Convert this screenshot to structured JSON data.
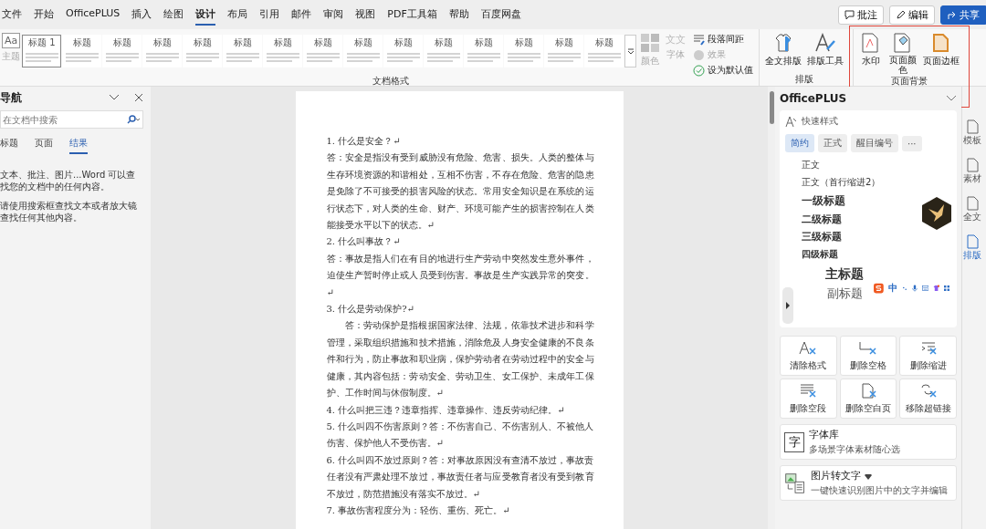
{
  "menu_tabs": [
    {
      "label": "文件",
      "selected": false
    },
    {
      "label": "开始",
      "selected": false
    },
    {
      "label": "OfficePLUS",
      "selected": false
    },
    {
      "label": "插入",
      "selected": false
    },
    {
      "label": "绘图",
      "selected": false
    },
    {
      "label": "设计",
      "selected": true
    },
    {
      "label": "布局",
      "selected": false
    },
    {
      "label": "引用",
      "selected": false
    },
    {
      "label": "邮件",
      "selected": false
    },
    {
      "label": "审阅",
      "selected": false
    },
    {
      "label": "视图",
      "selected": false
    },
    {
      "label": "PDF工具箱",
      "selected": false
    },
    {
      "label": "帮助",
      "selected": false
    },
    {
      "label": "百度网盘",
      "selected": false
    }
  ],
  "top_buttons": [
    {
      "label": "批注",
      "kind": "comment"
    },
    {
      "label": "编辑",
      "kind": "edit"
    },
    {
      "label": "共享",
      "kind": "share"
    }
  ],
  "ribbon": {
    "theme": {
      "icon_text": "Aa",
      "label": "主题",
      "disabled": true
    },
    "gallery": [
      {
        "title": "标题 1",
        "selected": true
      },
      {
        "title": "标题",
        "selected": false
      },
      {
        "title": "标题",
        "selected": false
      },
      {
        "title": "标题",
        "selected": false
      },
      {
        "title": "标题",
        "selected": false
      },
      {
        "title": "标题",
        "selected": false
      },
      {
        "title": "标题",
        "selected": false
      },
      {
        "title": "标题",
        "selected": false
      },
      {
        "title": "标题",
        "selected": false
      },
      {
        "title": "标题",
        "selected": false
      },
      {
        "title": "标题",
        "selected": false
      },
      {
        "title": "标题",
        "selected": false
      },
      {
        "title": "标题",
        "selected": false
      },
      {
        "title": "标题",
        "selected": false
      },
      {
        "title": "标题",
        "selected": false
      }
    ],
    "colors": {
      "label": "颜色",
      "disabled": true
    },
    "fonts": {
      "icon_text": "文文",
      "label": "字体",
      "disabled": true
    },
    "paragraph_options": [
      {
        "label": "段落间距",
        "kind": "spacing",
        "disabled": false
      },
      {
        "label": "效果",
        "kind": "effects",
        "disabled": true
      },
      {
        "label": "设为默认值",
        "kind": "default",
        "disabled": false
      }
    ],
    "format_group_label": "文档格式",
    "layout_group": {
      "label": "排版",
      "buttons": [
        {
          "label": "全文排版",
          "kind": "layout"
        },
        {
          "label": "排版工具",
          "kind": "tools"
        }
      ]
    },
    "background_group": {
      "label": "页面背景",
      "highlighted": true,
      "buttons": [
        {
          "label": "水印",
          "kind": "watermark"
        },
        {
          "label": "页面颜色",
          "kind": "color"
        },
        {
          "label": "页面边框",
          "kind": "border"
        }
      ]
    }
  },
  "nav": {
    "title": "导航",
    "search": {
      "placeholder": "在文档中搜索"
    },
    "tabs": [
      {
        "label": "标题",
        "selected": false
      },
      {
        "label": "页面",
        "selected": false
      },
      {
        "label": "结果",
        "selected": true
      }
    ],
    "messages": [
      "文本、批注、图片...Word 可以查找您的文档中的任何内容。",
      "请使用搜索框查找文本或者放大镜查找任何其他内容。"
    ]
  },
  "document": {
    "paragraphs": [
      {
        "text": "1. 什么是安全？↵",
        "first_line_indent": false
      },
      {
        "text": "答：安全是指没有受到威胁没有危险、危害、损失。人类的整体与生存环境资源的和谐相处，互相不伤害，不存在危险、危害的隐患是免除了不可接受的损害风险的状态。常用安全知识是在系统的运行状态下，对人类的生命、财产、环境可能产生的损害控制在人类能接受水平以下的状态。↵",
        "first_line_indent": false
      },
      {
        "text": "2. 什么叫事故？↵",
        "first_line_indent": false
      },
      {
        "text": "答：事故是指人们在有目的地进行生产劳动中突然发生意外事件，迫使生产暂时停止或人员受到伤害。事故是生产实践异常的突变。↵",
        "first_line_indent": false
      },
      {
        "text": "3. 什么是劳动保护?↵",
        "first_line_indent": false
      },
      {
        "text": "答：劳动保护是指根据国家法律、法规，依靠技术进步和科学管理，采取组织措施和技术措施，消除危及人身安全健康的不良条件和行为，防止事故和职业病，保护劳动者在劳动过程中的安全与健康，其内容包括：劳动安全、劳动卫生、女工保护、未成年工保护、工作时间与休假制度。↵",
        "first_line_indent": true
      },
      {
        "text": "4. 什么叫把三违？违章指挥、违章操作、违反劳动纪律。↵",
        "first_line_indent": false
      },
      {
        "text": "5. 什么叫四不伤害原则？答：不伤害自己、不伤害别人、不被他人伤害、保护他人不受伤害。↵",
        "first_line_indent": false
      },
      {
        "text": "6. 什么叫四不放过原则？答：对事故原因没有查清不放过，事故责任者没有严肃处理不放过，事故责任者与应受教育者没有受到教育不放过，防范措施没有落实不放过。↵",
        "first_line_indent": false
      },
      {
        "text": "7. 事故伤害程度分为：轻伤、重伤、死亡。↵",
        "first_line_indent": false
      }
    ]
  },
  "officeplus": {
    "title": "OfficePLUS",
    "quick_styles": {
      "title": "快速样式",
      "chips": [
        {
          "label": "简约",
          "selected": true
        },
        {
          "label": "正式",
          "selected": false
        },
        {
          "label": "醒目编号",
          "selected": false
        },
        {
          "label": "···",
          "selected": false
        }
      ],
      "styles": [
        {
          "label": "正文",
          "kind": "body"
        },
        {
          "label": "正文（首行缩进2）",
          "kind": "body"
        },
        {
          "label": "一级标题",
          "kind": "h1"
        },
        {
          "label": "二级标题",
          "kind": "h2"
        },
        {
          "label": "三级标题",
          "kind": "h3"
        },
        {
          "label": "四级标题",
          "kind": "h4"
        },
        {
          "label": "主标题",
          "kind": "title"
        },
        {
          "label": "副标题",
          "kind": "subtitle"
        }
      ]
    },
    "tools": [
      {
        "label": "清除格式",
        "kind": "clear-format"
      },
      {
        "label": "删除空格",
        "kind": "delete-spaces"
      },
      {
        "label": "删除缩进",
        "kind": "delete-indent"
      },
      {
        "label": "删除空段",
        "kind": "delete-paragraphs"
      },
      {
        "label": "删除空白页",
        "kind": "delete-page"
      },
      {
        "label": "移除超链接",
        "kind": "remove-link"
      }
    ],
    "features": [
      {
        "title": "字体库",
        "subtitle": "多场景字体素材随心选",
        "kind": "font",
        "premium": false,
        "icon_text": "字"
      },
      {
        "title": "图片转文字",
        "subtitle": "一键快速识别图片中的文字并编辑",
        "kind": "ocr",
        "premium": true
      }
    ]
  },
  "side_strip": [
    {
      "label": "模板",
      "selected": false
    },
    {
      "label": "素材",
      "selected": false
    },
    {
      "label": "全文",
      "selected": false
    },
    {
      "label": "排版",
      "selected": true
    }
  ],
  "ime_bar": {
    "label": "中"
  }
}
